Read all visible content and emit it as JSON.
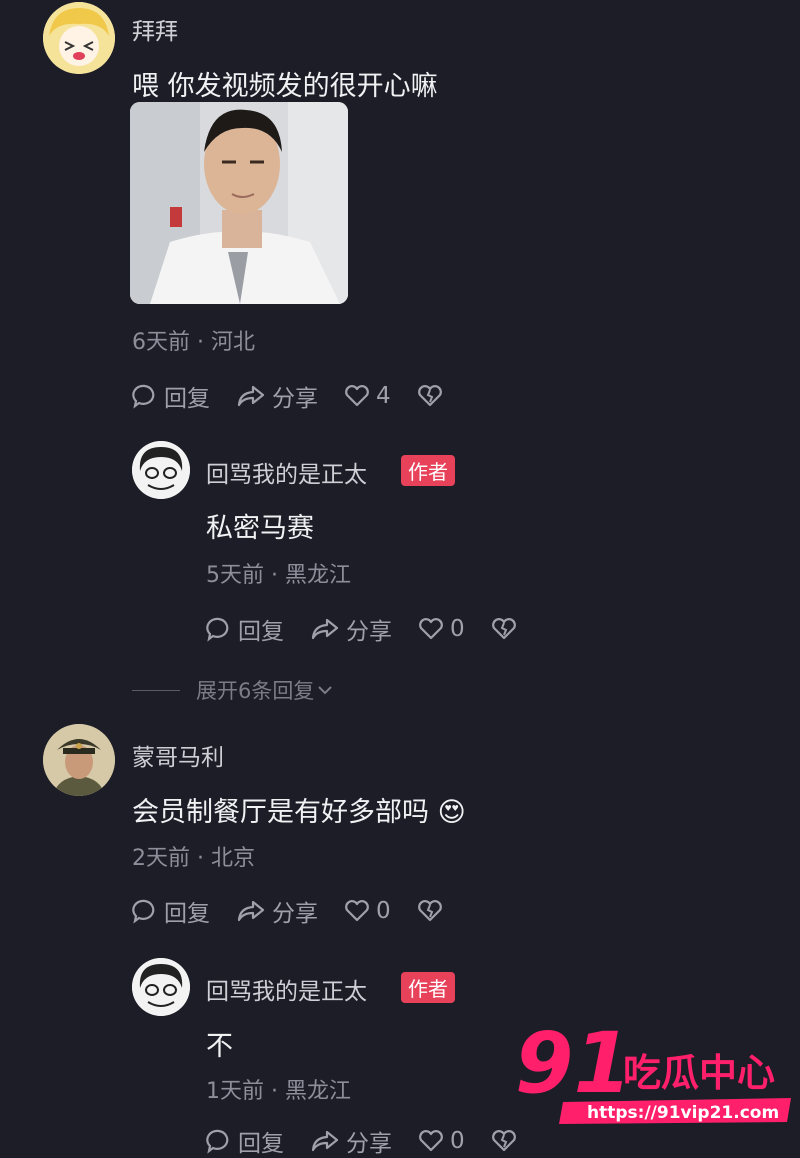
{
  "comments": [
    {
      "username": "拜拜",
      "text": "喂 你发视频发的很开心嘛",
      "meta": "6天前 · 河北",
      "actions": {
        "reply": "回复",
        "share": "分享",
        "likes": "4"
      },
      "reply": {
        "username": "回骂我的是正太",
        "badge": "作者",
        "text": "私密马赛",
        "meta": "5天前 · 黑龙江",
        "actions": {
          "reply": "回复",
          "share": "分享",
          "likes": "0"
        }
      },
      "expand": "展开6条回复"
    },
    {
      "username": "蒙哥马利",
      "text": "会员制餐厅是有好多部吗",
      "emoji": "😍",
      "meta": "2天前 · 北京",
      "actions": {
        "reply": "回复",
        "share": "分享",
        "likes": "0"
      },
      "reply": {
        "username": "回骂我的是正太",
        "badge": "作者",
        "text": "不",
        "meta": "1天前 · 黑龙江",
        "actions": {
          "reply": "回复",
          "share": "分享",
          "likes": "0"
        }
      }
    }
  ],
  "watermark": {
    "brand_number": "91",
    "brand_text": "吃瓜中心",
    "url": "https://91vip21.com"
  },
  "colors": {
    "background": "#1c1d26",
    "badge": "#e8415a",
    "watermark": "#ff1f6b"
  }
}
